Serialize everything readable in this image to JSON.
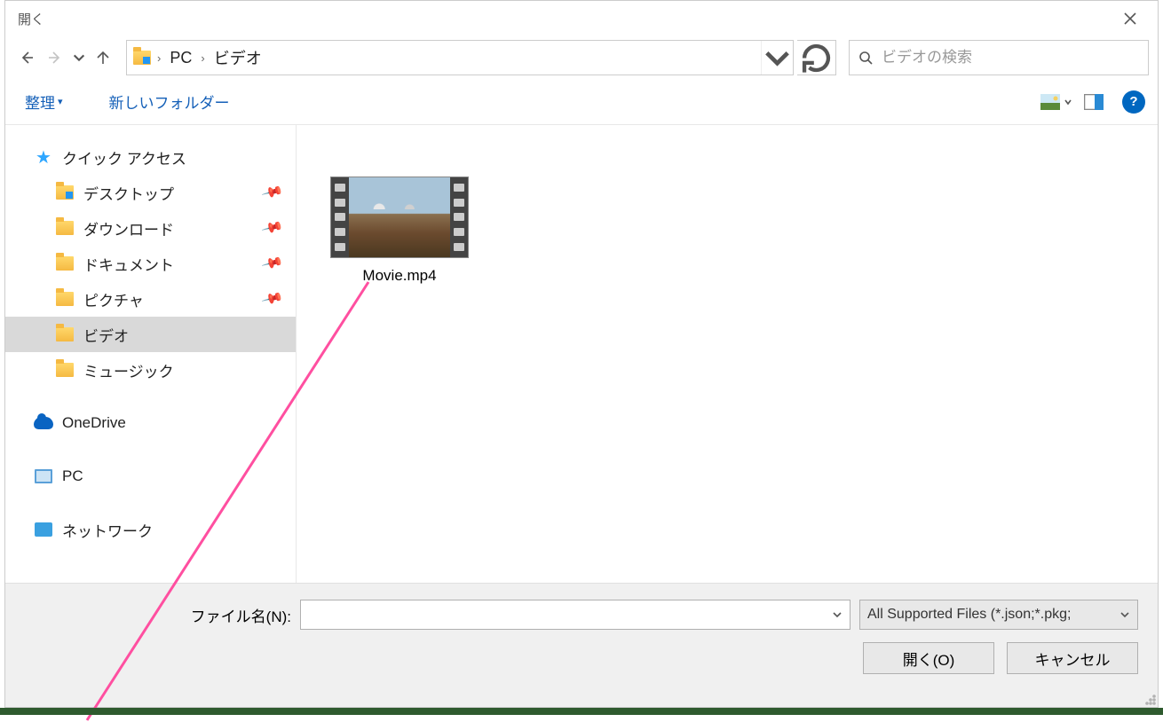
{
  "title": "開く",
  "nav": {
    "back": "back",
    "forward": "forward",
    "recent": "recent",
    "up": "up"
  },
  "breadcrumb": {
    "segments": [
      "PC",
      "ビデオ"
    ]
  },
  "search": {
    "placeholder": "ビデオの検索"
  },
  "toolbar": {
    "organize": "整理",
    "new_folder": "新しいフォルダー"
  },
  "sidebar": {
    "quick_access": "クイック アクセス",
    "items": [
      {
        "label": "デスクトップ",
        "icon": "desktop-folder",
        "pinned": true
      },
      {
        "label": "ダウンロード",
        "icon": "downloads-folder",
        "pinned": true
      },
      {
        "label": "ドキュメント",
        "icon": "documents-folder",
        "pinned": true
      },
      {
        "label": "ピクチャ",
        "icon": "pictures-folder",
        "pinned": true
      },
      {
        "label": "ビデオ",
        "icon": "videos-folder",
        "pinned": false,
        "selected": true
      },
      {
        "label": "ミュージック",
        "icon": "music-folder",
        "pinned": false
      }
    ],
    "onedrive": "OneDrive",
    "pc": "PC",
    "network": "ネットワーク"
  },
  "content": {
    "files": [
      {
        "name": "Movie.mp4",
        "type": "video"
      }
    ]
  },
  "footer": {
    "filename_label": "ファイル名(N):",
    "filename_value": "",
    "filetype": "All Supported Files (*.json;*.pkg;",
    "open": "開く(O)",
    "cancel": "キャンセル"
  }
}
